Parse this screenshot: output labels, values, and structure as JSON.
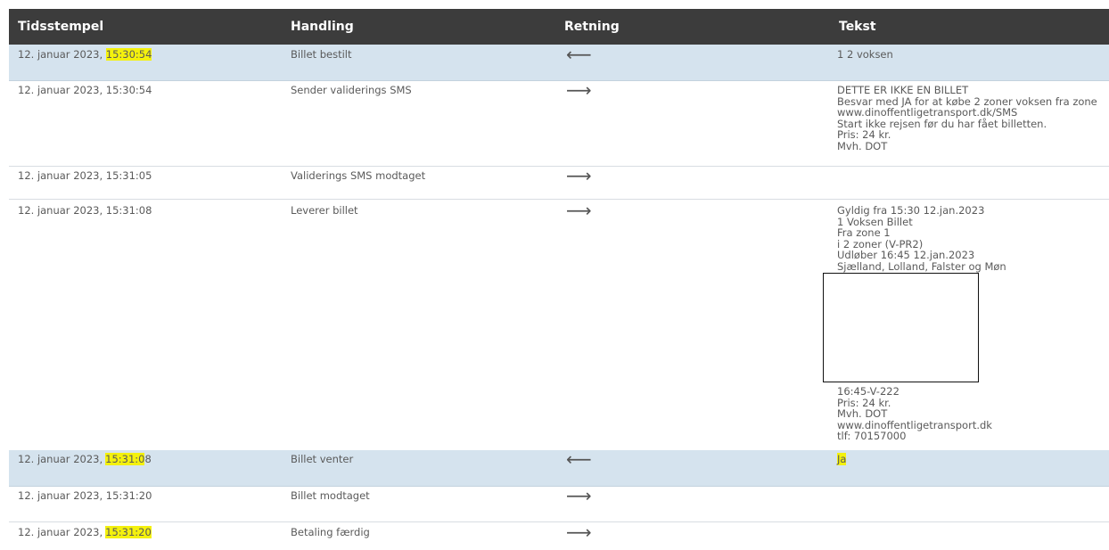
{
  "header": {
    "col_time": "Tidsstempel",
    "col_action": "Handling",
    "col_direction": "Retning",
    "col_text": "Tekst"
  },
  "rows": [
    {
      "time_a": "12. januar 2023, ",
      "time_b": "15:30:54",
      "action": "Billet bestilt",
      "arrow": "⟵",
      "text": [
        "1 2 voksen"
      ]
    },
    {
      "time": "12. januar 2023, 15:30:54",
      "action": "Sender validerings SMS",
      "arrow": "⟶",
      "text": [
        "DETTE ER IKKE EN BILLET",
        "Besvar med JA for at købe 2 zoner voksen fra zone",
        "www.dinoffentligetransport.dk/SMS",
        "Start ikke rejsen før du har fået billetten.",
        "Pris: 24 kr.",
        "Mvh. DOT"
      ]
    },
    {
      "time": "12. januar 2023, 15:31:05",
      "action": "Validerings SMS modtaget",
      "arrow": "⟶",
      "text": []
    },
    {
      "time": "12. januar 2023, 15:31:08",
      "action": "Leverer billet",
      "arrow": "⟶",
      "text_top": [
        "Gyldig fra 15:30 12.jan.2023",
        "1 Voksen Billet",
        "Fra zone 1",
        "i 2 zoner (V-PR2)",
        "Udløber 16:45 12.jan.2023",
        "Sjælland, Lolland, Falster og Møn"
      ],
      "text_bottom": [
        "16:45-V-222",
        "Pris: 24 kr.",
        "Mvh. DOT",
        "www.dinoffentligetransport.dk",
        "tlf: 70157000"
      ]
    },
    {
      "time_a": "12. januar 2023,",
      "time_b": "15:31:0",
      "time_c": "8",
      "action": "Billet venter",
      "arrow": "⟵",
      "text_mark": "Ja"
    },
    {
      "time": "12. januar 2023, 15:31:20",
      "action": "Billet modtaget",
      "arrow": "⟶",
      "text": []
    },
    {
      "time_a": "12. januar 2023,",
      "time_b": "15:31:20",
      "action": "Betaling færdig",
      "arrow": "⟶",
      "text": []
    }
  ],
  "colors": {
    "header_bg": "#3c3c3c",
    "highlight_row": "#d5e3ee",
    "marker": "#f4f10d"
  }
}
